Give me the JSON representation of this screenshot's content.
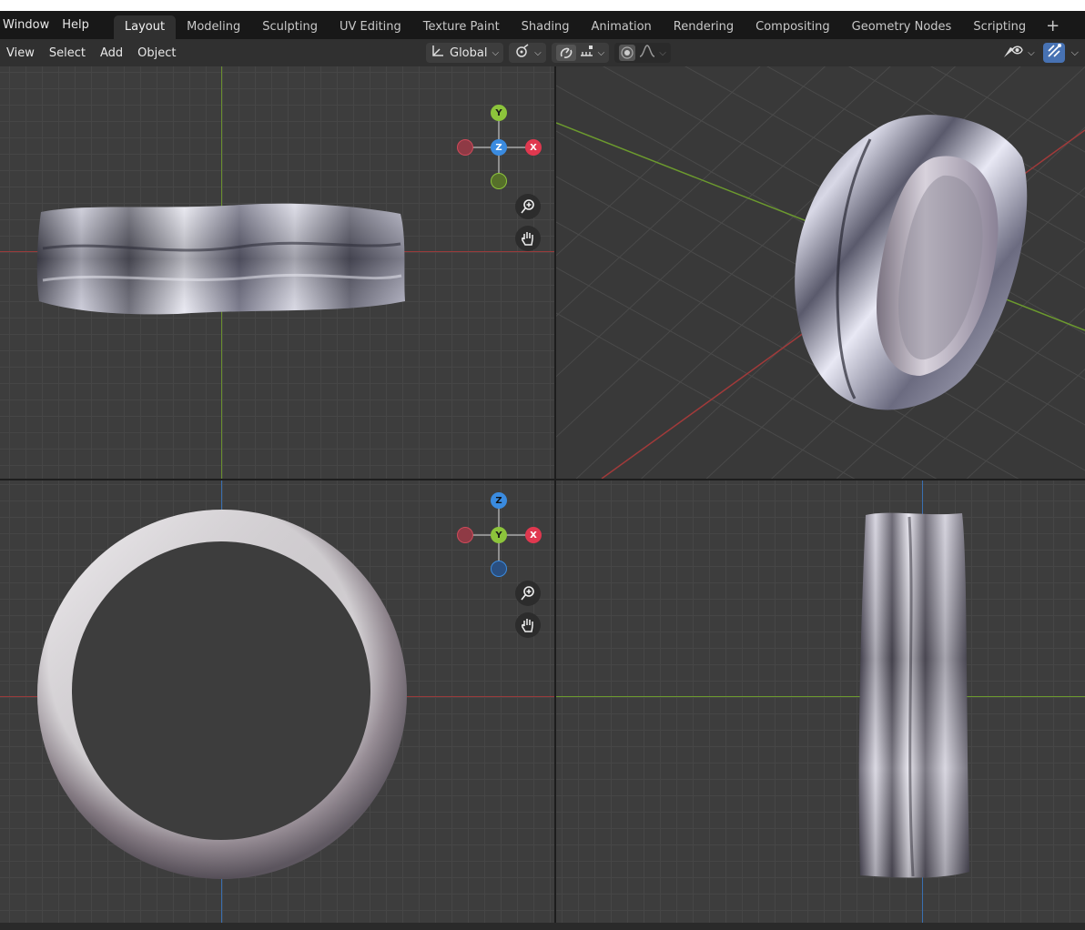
{
  "topbar": {
    "menus": [
      "Window",
      "Help"
    ],
    "tabs": [
      {
        "label": "Layout",
        "active": true
      },
      {
        "label": "Modeling",
        "active": false
      },
      {
        "label": "Sculpting",
        "active": false
      },
      {
        "label": "UV Editing",
        "active": false
      },
      {
        "label": "Texture Paint",
        "active": false
      },
      {
        "label": "Shading",
        "active": false
      },
      {
        "label": "Animation",
        "active": false
      },
      {
        "label": "Rendering",
        "active": false
      },
      {
        "label": "Compositing",
        "active": false
      },
      {
        "label": "Geometry Nodes",
        "active": false
      },
      {
        "label": "Scripting",
        "active": false
      }
    ],
    "add_tab_label": "+"
  },
  "header": {
    "menus": [
      "View",
      "Select",
      "Add",
      "Object"
    ],
    "transform_orientation": "Global",
    "icons": [
      "transform-orientation-icon",
      "pivot-icon",
      "snap-icon",
      "snap-increment-icon",
      "proportional-edit-icon",
      "falloff-icon",
      "visibility-icon",
      "gizmo-icon"
    ]
  },
  "viewports": {
    "top_left": {
      "view": "top",
      "gizmo_axes": [
        "Y",
        "Z",
        "X"
      ]
    },
    "top_right": {
      "view": "perspective"
    },
    "bottom_left": {
      "view": "front",
      "gizmo_axes": [
        "Z",
        "Y",
        "X"
      ]
    },
    "bottom_right": {
      "view": "right"
    }
  },
  "colors": {
    "x_axis": "#b34b4b",
    "y_axis": "#7fa83a",
    "z_axis": "#3a79c8",
    "tab_active": "#303030",
    "accent_blue": "#4772b3"
  }
}
